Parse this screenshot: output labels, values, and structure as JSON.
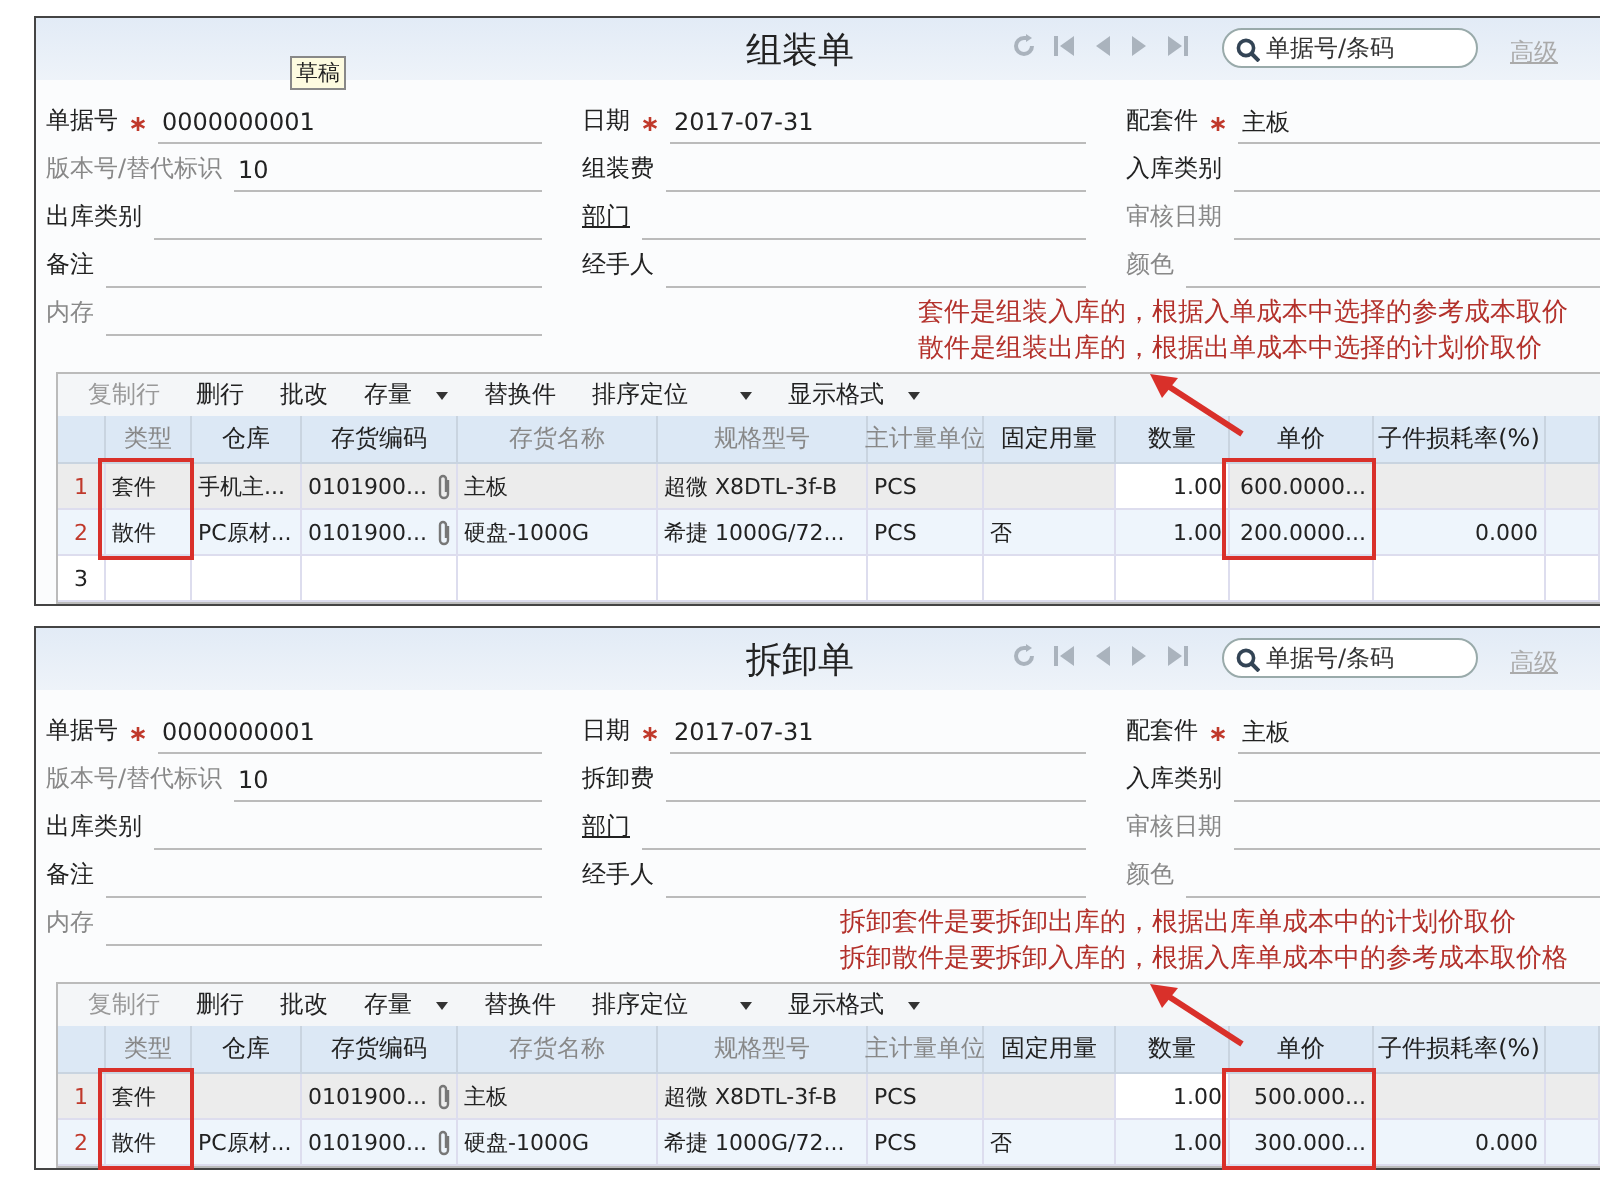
{
  "panels": [
    {
      "title": "组装单",
      "status_badge": "草稿",
      "search": {
        "placeholder": "单据号/条码"
      },
      "advanced_link": "高级",
      "fields": [
        {
          "label": "单据号",
          "required": true,
          "value": "0000000001",
          "disabled": false,
          "link": false
        },
        {
          "label": "日期",
          "required": true,
          "value": "2017-07-31",
          "disabled": false,
          "link": false
        },
        {
          "label": "配套件",
          "required": true,
          "value": "主板",
          "disabled": false,
          "link": false
        },
        {
          "label": "版本号/替代标识",
          "required": false,
          "value": "10",
          "disabled": true,
          "link": false
        },
        {
          "label": "组装费",
          "required": false,
          "disabled": false,
          "link": false
        },
        {
          "label": "入库类别",
          "required": false,
          "disabled": false,
          "link": false
        },
        {
          "label": "出库类别",
          "required": false,
          "disabled": false,
          "link": false
        },
        {
          "label": "部门",
          "required": false,
          "disabled": false,
          "link": true
        },
        {
          "label": "审核日期",
          "required": false,
          "disabled": true,
          "link": false
        },
        {
          "label": "备注",
          "required": false,
          "disabled": false,
          "link": false
        },
        {
          "label": "经手人",
          "required": false,
          "disabled": false,
          "link": false
        },
        {
          "label": "颜色",
          "required": false,
          "disabled": true,
          "link": false
        },
        {
          "label": "内存",
          "required": false,
          "disabled": true,
          "link": false
        }
      ],
      "notes": [
        "套件是组装入库的，根据入单成本中选择的参考成本取价",
        "散件是组装出库的，根据出单成本中选择的计划价取价"
      ],
      "toolbar": [
        {
          "label": "复制行",
          "disabled": true,
          "dropdown": false
        },
        {
          "label": "删行",
          "disabled": false,
          "dropdown": false
        },
        {
          "label": "批改",
          "disabled": false,
          "dropdown": false
        },
        {
          "label": "存量",
          "disabled": false,
          "dropdown": true
        },
        {
          "label": "替换件",
          "disabled": false,
          "dropdown": false
        },
        {
          "label": "排序定位",
          "disabled": false,
          "dropdown": true
        },
        {
          "label": "显示格式",
          "disabled": false,
          "dropdown": true
        }
      ],
      "columns": [
        {
          "label": "类型",
          "kind": "text",
          "disabled": true,
          "highlighted": true
        },
        {
          "label": "仓库",
          "kind": "text",
          "disabled": false,
          "highlighted": false
        },
        {
          "label": "存货编码",
          "kind": "code",
          "disabled": false,
          "highlighted": false
        },
        {
          "label": "存货名称",
          "kind": "text",
          "disabled": true,
          "highlighted": false
        },
        {
          "label": "规格型号",
          "kind": "text",
          "disabled": true,
          "highlighted": false
        },
        {
          "label": "主计量单位",
          "kind": "text",
          "disabled": true,
          "highlighted": false
        },
        {
          "label": "固定用量",
          "kind": "text",
          "disabled": false,
          "highlighted": false
        },
        {
          "label": "数量",
          "kind": "number",
          "disabled": false,
          "highlighted": false
        },
        {
          "label": "单价",
          "kind": "number",
          "disabled": false,
          "highlighted": true
        },
        {
          "label": "子件损耗率(%)",
          "kind": "number",
          "disabled": false,
          "highlighted": false
        }
      ],
      "rows": [
        {
          "number": "1",
          "cells": [
            "套件",
            "手机主...",
            "0101900...",
            "主板",
            "超微 X8DTL-3f-B",
            "PCS",
            null,
            "1.00",
            "600.0000...",
            null
          ]
        },
        {
          "number": "2",
          "cells": [
            "散件",
            "PC原材...",
            "0101900...",
            "硬盘-1000G",
            "希捷 1000G/72...",
            "PCS",
            "否",
            "1.00",
            "200.0000...",
            "0.000"
          ]
        },
        {
          "number": "3"
        }
      ]
    },
    {
      "title": "拆卸单",
      "search": {
        "placeholder": "单据号/条码"
      },
      "advanced_link": "高级",
      "fields": [
        {
          "label": "单据号",
          "required": true,
          "value": "0000000001",
          "disabled": false,
          "link": false
        },
        {
          "label": "日期",
          "required": true,
          "value": "2017-07-31",
          "disabled": false,
          "link": false
        },
        {
          "label": "配套件",
          "required": true,
          "value": "主板",
          "disabled": false,
          "link": false
        },
        {
          "label": "版本号/替代标识",
          "required": false,
          "value": "10",
          "disabled": true,
          "link": false
        },
        {
          "label": "拆卸费",
          "required": false,
          "disabled": false,
          "link": false
        },
        {
          "label": "入库类别",
          "required": false,
          "disabled": false,
          "link": false
        },
        {
          "label": "出库类别",
          "required": false,
          "disabled": false,
          "link": false
        },
        {
          "label": "部门",
          "required": false,
          "disabled": false,
          "link": true
        },
        {
          "label": "审核日期",
          "required": false,
          "disabled": true,
          "link": false
        },
        {
          "label": "备注",
          "required": false,
          "disabled": false,
          "link": false
        },
        {
          "label": "经手人",
          "required": false,
          "disabled": false,
          "link": false
        },
        {
          "label": "颜色",
          "required": false,
          "disabled": true,
          "link": false
        },
        {
          "label": "内存",
          "required": false,
          "disabled": true,
          "link": false
        }
      ],
      "notes": [
        "拆卸套件是要拆卸出库的，根据出库单成本中的计划价取价",
        "拆卸散件是要拆卸入库的，根据入库单成本中的参考成本取价格"
      ],
      "toolbar": [
        {
          "label": "复制行",
          "disabled": true,
          "dropdown": false
        },
        {
          "label": "删行",
          "disabled": false,
          "dropdown": false
        },
        {
          "label": "批改",
          "disabled": false,
          "dropdown": false
        },
        {
          "label": "存量",
          "disabled": false,
          "dropdown": true
        },
        {
          "label": "替换件",
          "disabled": false,
          "dropdown": false
        },
        {
          "label": "排序定位",
          "disabled": false,
          "dropdown": true
        },
        {
          "label": "显示格式",
          "disabled": false,
          "dropdown": true
        }
      ],
      "columns": [
        {
          "label": "类型",
          "kind": "text",
          "disabled": true,
          "highlighted": true
        },
        {
          "label": "仓库",
          "kind": "text",
          "disabled": false,
          "highlighted": false
        },
        {
          "label": "存货编码",
          "kind": "code",
          "disabled": false,
          "highlighted": false
        },
        {
          "label": "存货名称",
          "kind": "text",
          "disabled": true,
          "highlighted": false
        },
        {
          "label": "规格型号",
          "kind": "text",
          "disabled": true,
          "highlighted": false
        },
        {
          "label": "主计量单位",
          "kind": "text",
          "disabled": true,
          "highlighted": false
        },
        {
          "label": "固定用量",
          "kind": "text",
          "disabled": false,
          "highlighted": false
        },
        {
          "label": "数量",
          "kind": "number",
          "disabled": false,
          "highlighted": false
        },
        {
          "label": "单价",
          "kind": "number",
          "disabled": false,
          "highlighted": true
        },
        {
          "label": "子件损耗率(%)",
          "kind": "number",
          "disabled": false,
          "highlighted": false
        }
      ],
      "rows": [
        {
          "number": "1",
          "cells": [
            "套件",
            null,
            "0101900...",
            "主板",
            "超微 X8DTL-3f-B",
            "PCS",
            null,
            "1.00",
            "500.000...",
            null
          ]
        },
        {
          "number": "2",
          "cells": [
            "散件",
            "PC原材...",
            "0101900...",
            "硬盘-1000G",
            "希捷 1000G/72...",
            "PCS",
            "否",
            "1.00",
            "300.000...",
            "0.000"
          ]
        }
      ]
    }
  ]
}
